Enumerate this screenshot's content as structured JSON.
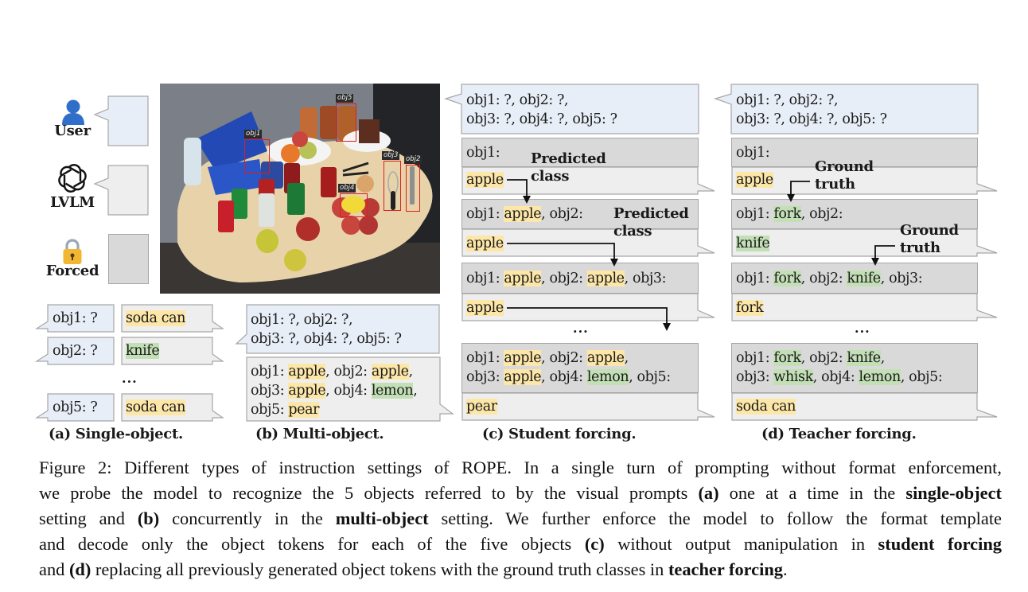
{
  "legend": {
    "user_label": "User",
    "lvlm_label": "LVLM",
    "forced_label": "Forced",
    "icons": [
      "person-icon",
      "openai-logo-icon",
      "lock-icon"
    ],
    "colors": {
      "user_bubble": "#e8eef7",
      "lvlm_bubble": "#eeeeee",
      "forced_box": "#d9d9d9"
    }
  },
  "highlight_colors": {
    "predicted": "#fde7a8",
    "correct": "#c3dfb6"
  },
  "photo": {
    "description": "Table with fruits, soda cans, snacks and utensils",
    "tags": [
      "obj1",
      "obj2",
      "obj3",
      "obj4",
      "obj5"
    ]
  },
  "panel_a": {
    "rows": [
      {
        "prompt": "obj1: ?",
        "answer": "soda can",
        "answer_style": "predicted"
      },
      {
        "prompt": "obj2: ?",
        "answer": "knife",
        "answer_style": "correct"
      },
      {
        "prompt": "obj5: ?",
        "answer": "soda can",
        "answer_style": "predicted"
      }
    ],
    "ellipsis": "...",
    "caption": "(a) Single-object."
  },
  "panel_b": {
    "prompt_line1": "obj1: ?, obj2: ?,",
    "prompt_line2": "obj3: ?, obj4: ?, obj5: ?",
    "answer": {
      "l1_a": "obj1: ",
      "l1_b": "apple",
      "l1_c": ", obj2: ",
      "l1_d": "apple",
      "l1_e": ",",
      "l2_a": "obj3: ",
      "l2_b": "apple",
      "l2_c": ", obj4: ",
      "l2_d": "lemon",
      "l2_e": ",",
      "l3_a": "obj5: ",
      "l3_b": "pear"
    },
    "caption": "(b) Multi-object."
  },
  "panel_c": {
    "prompt_line1": "obj1: ?, obj2: ?,",
    "prompt_line2": "obj3: ?, obj4: ?, obj5: ?",
    "step1": {
      "forced": "obj1:",
      "answer": "apple"
    },
    "step2": {
      "forced_a": "obj1: ",
      "forced_b": "apple",
      "forced_c": ", obj2:",
      "answer": "apple"
    },
    "step3": {
      "forced_a": "obj1: ",
      "forced_b": "apple",
      "forced_c": ", obj2: ",
      "forced_d": "apple",
      "forced_e": ", obj3:",
      "answer": "apple"
    },
    "ellipsis": "...",
    "final": {
      "l1_a": "obj1: ",
      "l1_b": "apple",
      "l1_c": ", obj2: ",
      "l1_d": "apple",
      "l1_e": ",",
      "l2_a": "obj3: ",
      "l2_b": "apple",
      "l2_c": ", obj4: ",
      "l2_d": "lemon",
      "l2_e": ", obj5:",
      "answer": "pear"
    },
    "annotation_1_line1": "Predicted",
    "annotation_1_line2": "class",
    "annotation_2_line1": "Predicted",
    "annotation_2_line2": "class",
    "caption": "(c) Student forcing."
  },
  "panel_d": {
    "prompt_line1": "obj1: ?, obj2: ?,",
    "prompt_line2": "obj3: ?, obj4: ?, obj5: ?",
    "step1": {
      "forced": "obj1:",
      "answer": "apple"
    },
    "step2": {
      "forced_a": "obj1: ",
      "forced_b": "fork",
      "forced_c": ", obj2:",
      "answer": "knife"
    },
    "step3": {
      "forced_a": "obj1: ",
      "forced_b": "fork",
      "forced_c": ", obj2: ",
      "forced_d": "knife",
      "forced_e": ", obj3:",
      "answer": "fork"
    },
    "ellipsis": "...",
    "final": {
      "l1_a": "obj1: ",
      "l1_b": "fork",
      "l1_c": ", obj2: ",
      "l1_d": "knife",
      "l1_e": ",",
      "l2_a": "obj3: ",
      "l2_b": "whisk",
      "l2_c": ", obj4: ",
      "l2_d": "lemon",
      "l2_e": ", obj5:",
      "answer": "soda can"
    },
    "annotation_1_line1": "Ground",
    "annotation_1_line2": "truth",
    "annotation_2_line1": "Ground",
    "annotation_2_line2": "truth",
    "caption": "(d) Teacher forcing."
  },
  "figure_caption": {
    "line1": "Figure 2: Different types of instruction settings of ROPE. In a single turn of prompting without format enforcement,",
    "line2_a": "we probe the model to recognize the 5 objects referred to by the visual prompts ",
    "line2_b": "(a)",
    "line2_c": " one at a time in the ",
    "line2_d": "single-object",
    "line3_a": "setting and ",
    "line3_b": "(b)",
    "line3_c": " concurrently in the ",
    "line3_d": "multi-object",
    "line3_e": " setting. We further enforce the model to follow the format template",
    "line4_a": "and decode only the object tokens for each of the five objects ",
    "line4_b": "(c)",
    "line4_c": " without output manipulation in ",
    "line4_d": "student forcing",
    "line5_a": "and ",
    "line5_b": "(d)",
    "line5_c": " replacing all previously generated object tokens with the ground truth classes in ",
    "line5_d": "teacher forcing",
    "line5_e": "."
  }
}
